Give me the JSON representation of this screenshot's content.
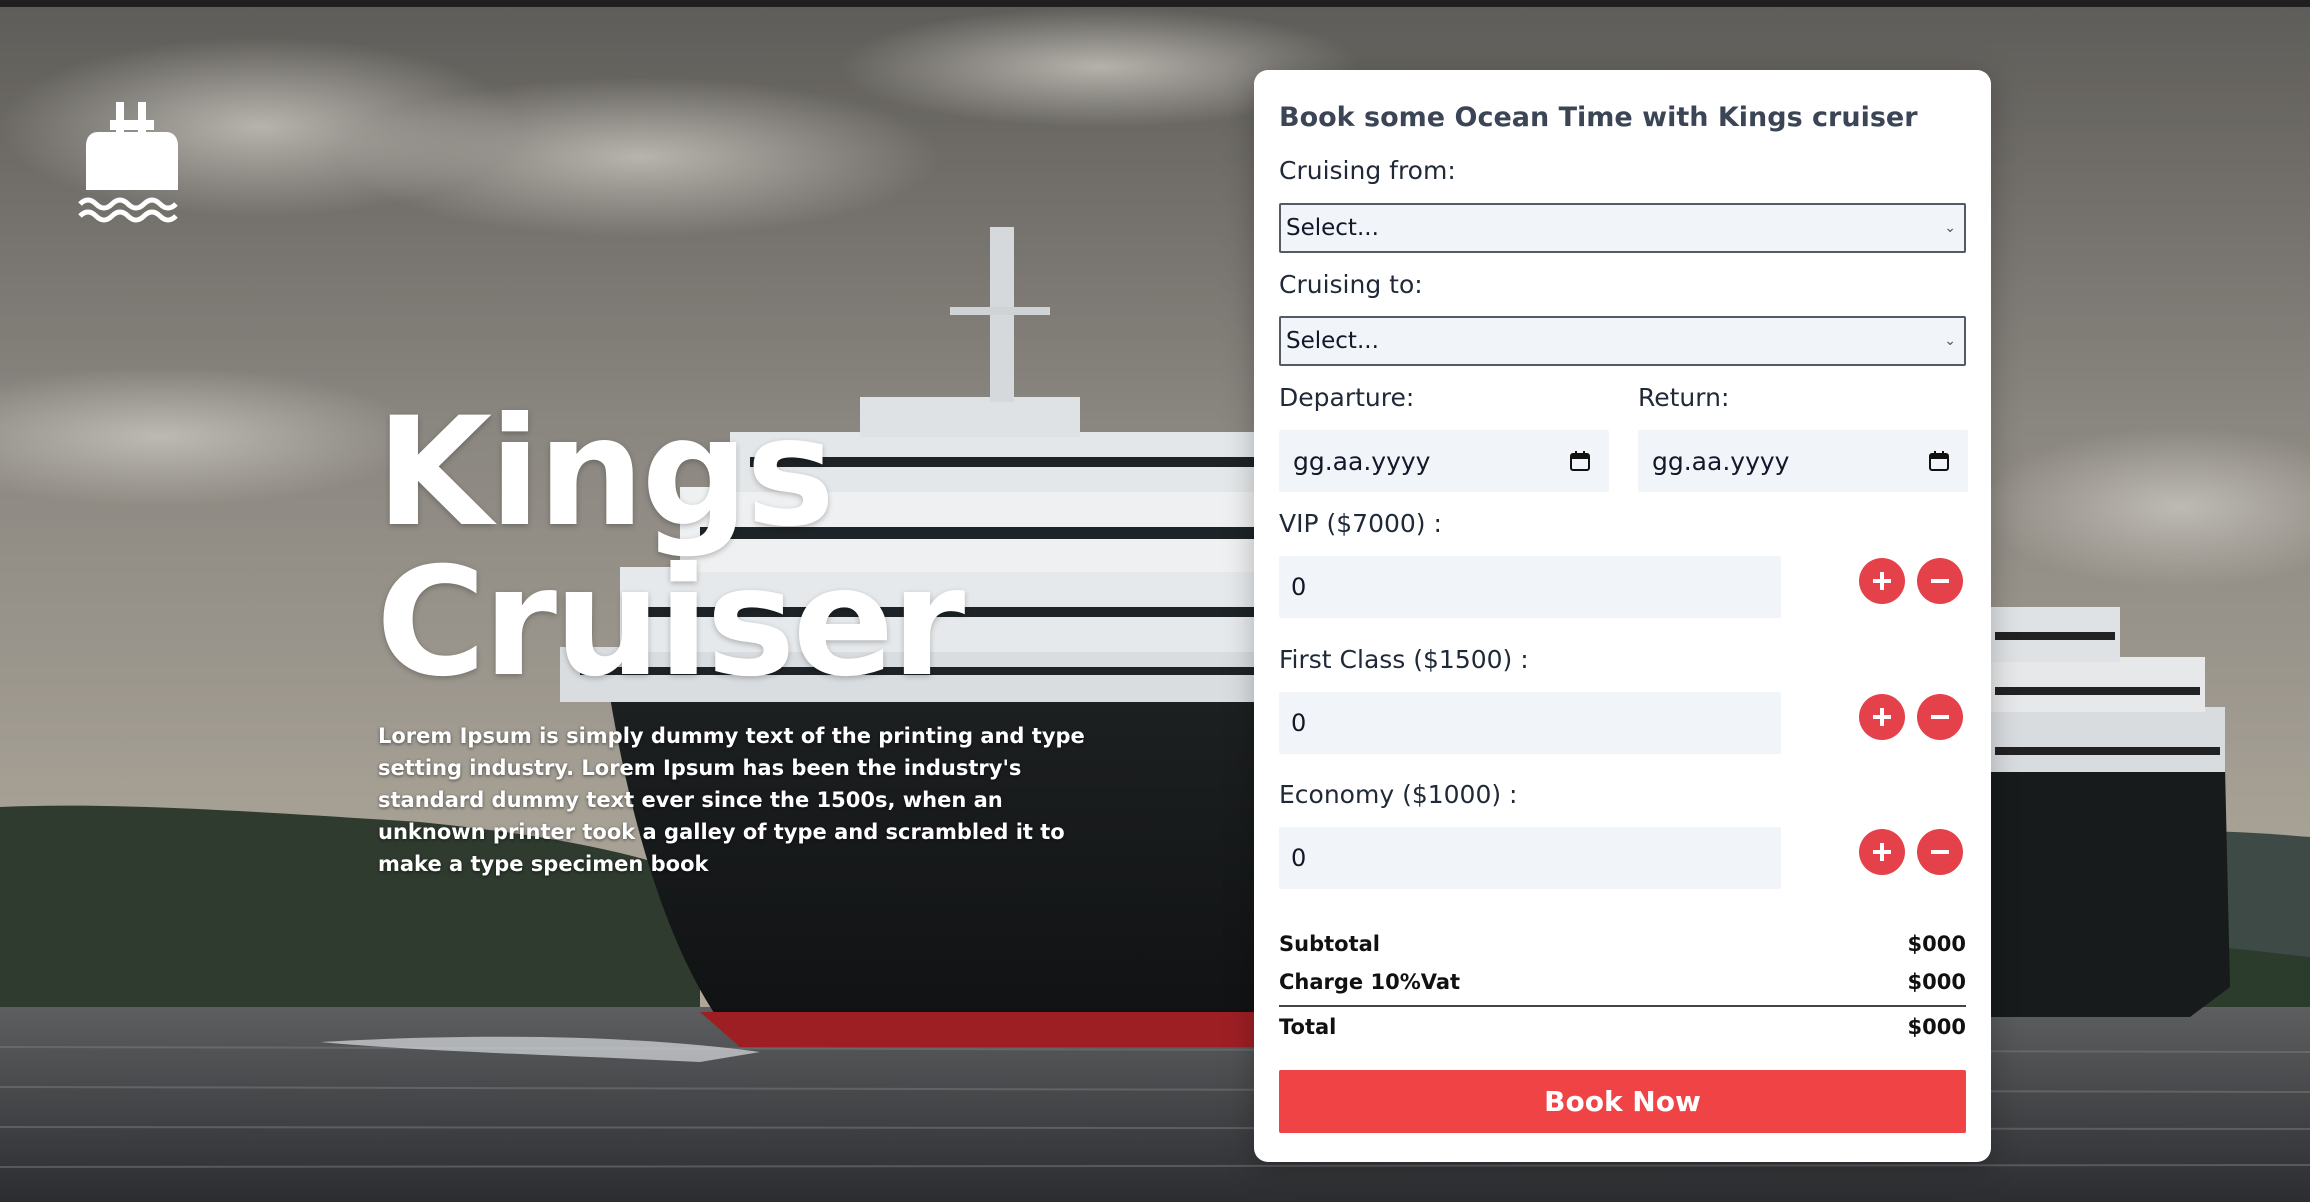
{
  "brand": {
    "logo_icon": "ship-icon",
    "hero_title_line1": "Kings",
    "hero_title_line2": "Cruiser",
    "hero_description": "Lorem Ipsum is simply dummy text of the printing and type setting industry. Lorem Ipsum has been the industry's standard dummy text ever since the 1500s, when an unknown printer took a galley of type and scrambled it to make a type specimen book"
  },
  "booking": {
    "title": "Book some Ocean Time with Kings cruiser",
    "from_label": "Cruising from:",
    "from_value": "Select...",
    "to_label": "Cruising to:",
    "to_value": "Select...",
    "departure_label": "Departure:",
    "departure_placeholder": "gg.aa.yyyy",
    "return_label": "Return:",
    "return_placeholder": "gg.aa.yyyy",
    "tickets": [
      {
        "label": "VIP ($7000) :",
        "value": "0"
      },
      {
        "label": "First Class ($1500) :",
        "value": "0"
      },
      {
        "label": "Economy ($1000) :",
        "value": "0"
      }
    ],
    "subtotal_label": "Subtotal",
    "subtotal_value": "$000",
    "vat_label": "Charge 10%Vat",
    "vat_value": "$000",
    "total_label": "Total",
    "total_value": "$000",
    "book_button": "Book Now"
  },
  "colors": {
    "accent": "#ef4346",
    "card_title": "#3b4556",
    "input_bg": "#f1f4f8"
  }
}
